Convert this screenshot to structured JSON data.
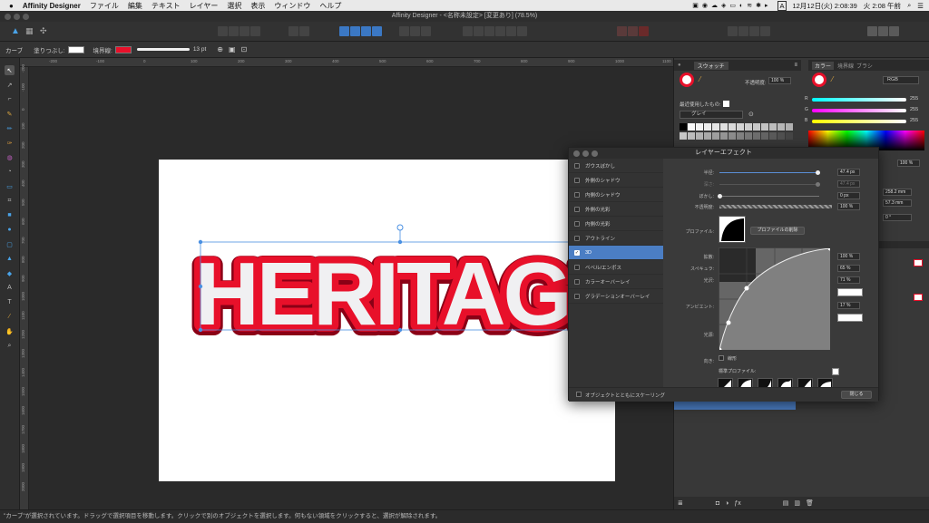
{
  "menubar": {
    "apple": "",
    "app": "Affinity Designer",
    "items": [
      "ファイル",
      "編集",
      "テキスト",
      "レイヤー",
      "選択",
      "表示",
      "ウィンドウ",
      "ヘルプ"
    ],
    "clock": "12月12日(火) 2:08:39",
    "clock2": "火 2:08 午前",
    "lang": "A"
  },
  "window": {
    "title": "Affinity Designer - <名称未設定> [変更あり] (78.5%)"
  },
  "context": {
    "tool": "カーブ",
    "fill_label": "塗りつぶし:",
    "stroke_label": "境界線:",
    "stroke_width": "13 pt",
    "fill_color": "#ffffff",
    "stroke_color": "#e8102a"
  },
  "ruler": {
    "h": [
      "-200",
      "-100",
      "0",
      "100",
      "200",
      "300",
      "400",
      "500",
      "600",
      "700",
      "800",
      "900",
      "1000",
      "1100"
    ],
    "v": [
      "-200",
      "-100",
      "0",
      "100",
      "200",
      "300",
      "400",
      "500",
      "600",
      "700",
      "800",
      "900",
      "1000",
      "1100",
      "1200",
      "1300",
      "1400",
      "1500",
      "1600",
      "1700",
      "1800",
      "1900",
      "2000"
    ]
  },
  "artwork": {
    "text": "HERITAGE",
    "fill": "#f0f0f2",
    "stroke": "#e8102a"
  },
  "panels": {
    "swatches_tab": "スウォッチ",
    "color_tab": "カラー",
    "stroke_tab": "境界線",
    "brush_tab": "ブラシ",
    "opacity_label": "不透明度:",
    "opacity_value": "100 %",
    "recent_label": "最近使用したもの:",
    "palette_name": "グレイ",
    "color_model": "RGB",
    "r_label": "R",
    "r_value": "255",
    "g_label": "G",
    "g_value": "255",
    "b_label": "B",
    "b_value": "255",
    "opacity_value2": "100 %",
    "w_value": "258.2 mm",
    "h_value": "57.3 mm",
    "rot_value": "0 °"
  },
  "dialog": {
    "title": "レイヤーエフェクト",
    "effects": [
      {
        "label": "ガウスぼかし",
        "checked": false
      },
      {
        "label": "外側のシャドウ",
        "checked": false
      },
      {
        "label": "内側のシャドウ",
        "checked": false
      },
      {
        "label": "外側の光彩",
        "checked": false
      },
      {
        "label": "内側の光彩",
        "checked": false
      },
      {
        "label": "アウトライン",
        "checked": false
      },
      {
        "label": "3D",
        "checked": true
      },
      {
        "label": "ベベル/エンボス",
        "checked": false
      },
      {
        "label": "カラーオーバーレイ",
        "checked": false
      },
      {
        "label": "グラデーションオーバーレイ",
        "checked": false
      }
    ],
    "radius_label": "半径:",
    "radius_value": "47.4 px",
    "depth_label": "深さ:",
    "depth_value": "47.4 px",
    "blur_label": "ぼかし:",
    "blur_value": "0 px",
    "opacity_label": "不透明度:",
    "opacity_value": "100 %",
    "profile_label": "プロファイル:",
    "profile_delete": "プロファイルの削除",
    "diffuse_label": "拡散:",
    "diffuse_value": "100 %",
    "specular_label": "スペキュラ:",
    "specular_value": "65 %",
    "gloss_label": "光沢:",
    "gloss_value": "71 %",
    "ambient_label": "アンビエント:",
    "ambient_value": "17 %",
    "light_label": "光源:",
    "direction_label": "向き:",
    "linear_label": "線形",
    "std_profiles_label": "標準プロファイル:",
    "scale_label": "オブジェクトとともにスケーリング",
    "close_label": "閉じる"
  },
  "status": {
    "text": "\"カーブ\"が選択されています。ドラッグで選択項目を移動します。クリックで別のオブジェクトを選択します。何もない領域をクリックすると、選択が解除されます。"
  }
}
